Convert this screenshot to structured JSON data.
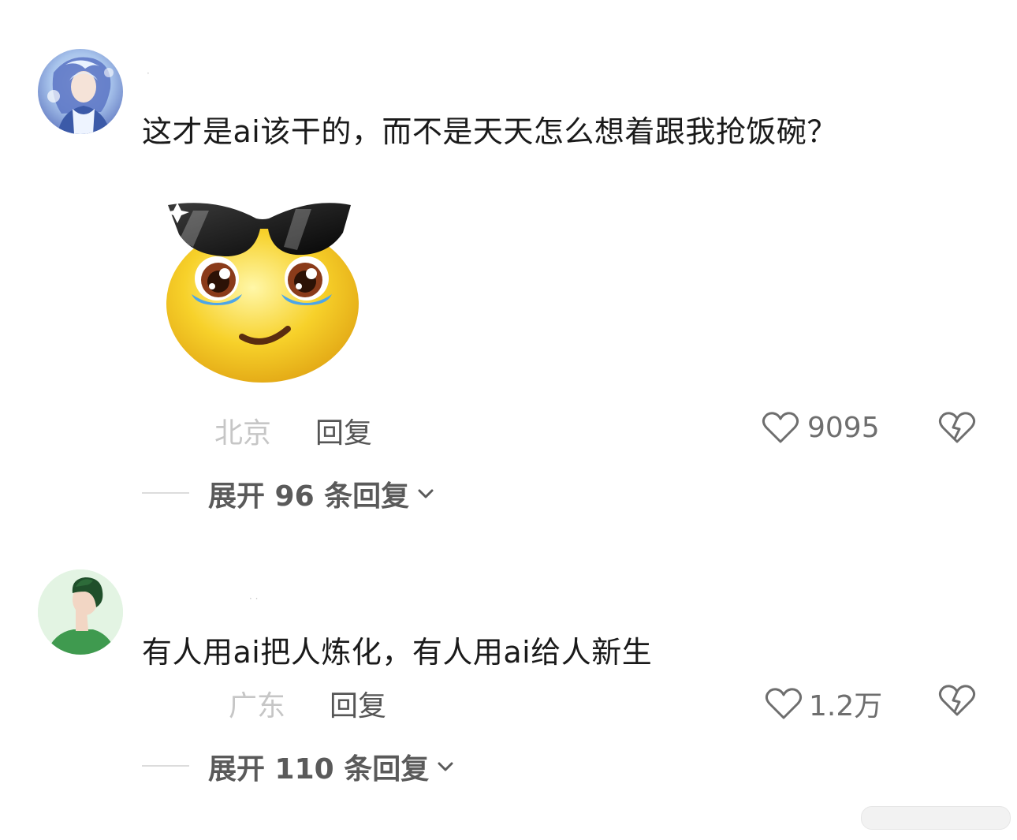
{
  "comments": [
    {
      "text": "这才是ai该干的，而不是天天怎么想着跟我抢饭碗？",
      "location": "北京",
      "reply_label": "回复",
      "likes": "9095",
      "expand_label": "展开 96 条回复"
    },
    {
      "text": "有人用ai把人炼化，有人用ai给人新生",
      "location": "广东",
      "reply_label": "回复",
      "likes": "1.2万",
      "expand_label": "展开 110 条回复"
    }
  ],
  "icons": {
    "like": "heart-outline-icon",
    "dislike": "broken-heart-icon",
    "expand": "chevron-down-icon",
    "sticker": "cool-crying-smile-sticker"
  },
  "colors": {
    "text_primary": "#1a1a1a",
    "text_secondary": "#6e6e6e",
    "location": "#c6c6c6",
    "sticker_yellow": "#f7d12a"
  }
}
